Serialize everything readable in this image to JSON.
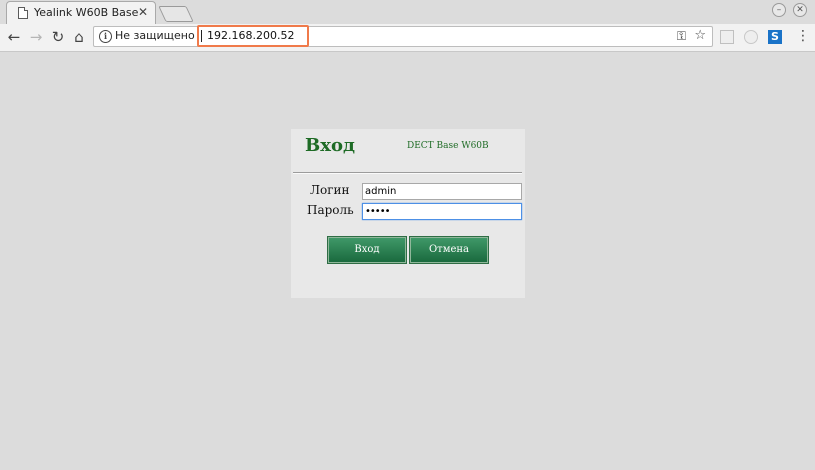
{
  "browser": {
    "tab_title": "Yealink W60B Base",
    "security_label": "Не защищено",
    "url": "192.168.200.52"
  },
  "login": {
    "heading": "Вход",
    "device_name": "DECT Base W60B",
    "username_label": "Логин",
    "username_value": "admin",
    "password_label": "Пароль",
    "password_value": "•••••",
    "login_button": "Вход",
    "cancel_button": "Отмена"
  },
  "colors": {
    "accent_green": "#1e6b25",
    "url_highlight": "#f07a4a"
  }
}
